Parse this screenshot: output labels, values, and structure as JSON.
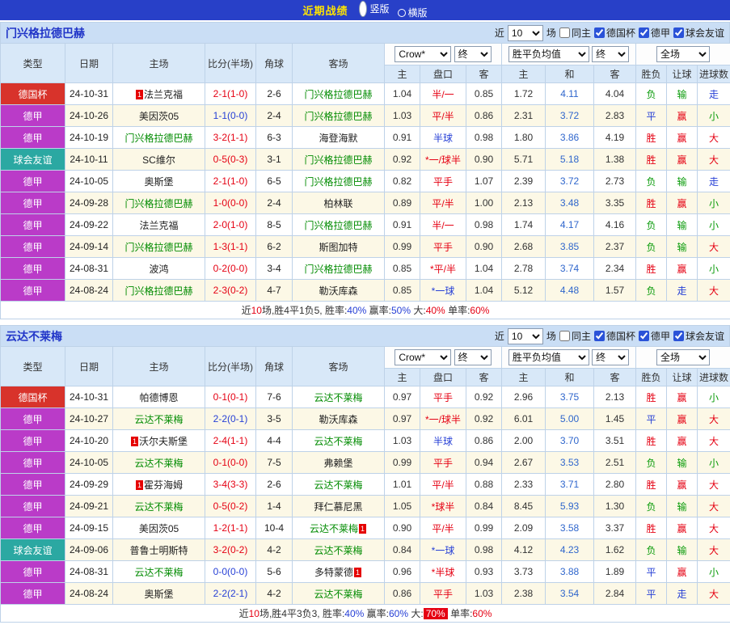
{
  "top_bar": {
    "title": "近期战绩",
    "view_options": [
      {
        "name": "vertical",
        "label": "竖版",
        "selected": true
      },
      {
        "name": "horizontal",
        "label": "横版",
        "selected": false
      }
    ]
  },
  "columns": {
    "main": [
      "类型",
      "日期",
      "主场",
      "比分(半场)",
      "角球",
      "客场"
    ],
    "sub": [
      "主",
      "盘口",
      "客",
      "主",
      "和",
      "客",
      "胜负",
      "让球",
      "进球数"
    ]
  },
  "palette": {
    "topbar_blue": "#2840C8",
    "title_yellow": "#FFE400",
    "section_head_blue": "#CADEF5",
    "table_head_blue": "#D8E8F8",
    "cup_red": "#D8332B",
    "league_purple": "#BA3BC8",
    "friendly_teal": "#2BA8A2",
    "subject_green": "#008B00",
    "win_red": "#E50012",
    "draw_blue": "#2740D6",
    "lose_green": "#0A9B0A",
    "row_stripe_cream": "#FCF8E6"
  },
  "type_colors": {
    "德国杯": "cup",
    "德甲": "league",
    "球会友谊": "friendly"
  },
  "result_colors": {
    "胜": "red",
    "平": "blue",
    "负": "green",
    "赢": "red",
    "输": "green",
    "走": "blue",
    "大": "red",
    "小": "green"
  },
  "sections": [
    {
      "id": "gladbach",
      "team": "门兴格拉德巴赫",
      "filters": {
        "near": "近",
        "count": "10",
        "unit": "场",
        "checkboxes": [
          {
            "name": "same-home",
            "label": "同主",
            "checked": false
          },
          {
            "name": "german-cup",
            "label": "德国杯",
            "checked": true
          },
          {
            "name": "bundesliga",
            "label": "德甲",
            "checked": true
          },
          {
            "name": "club-friendly",
            "label": "球会友谊",
            "checked": true
          }
        ]
      },
      "selects": {
        "odds": "Crow*",
        "odds_final": "终",
        "europe": "胜平负均值",
        "europe_final": "终",
        "scope": "全场"
      },
      "rows": [
        {
          "type": "德国杯",
          "date": "24-10-31",
          "home": "法兰克福",
          "hb": "before",
          "score": "2-1(1-0)",
          "sc": "red",
          "corner": "2-6",
          "away": "门兴格拉德巴赫",
          "sub": "a",
          "h": "1.04",
          "hcap": "半/一",
          "hc": "red",
          "a": "0.85",
          "eh": "1.72",
          "ed": "4.11",
          "ea": "4.04",
          "wl": "负",
          "rang": "输",
          "goal": "走"
        },
        {
          "type": "德甲",
          "date": "24-10-26",
          "home": "美因茨05",
          "score": "1-1(0-0)",
          "sc": "blue",
          "corner": "2-4",
          "away": "门兴格拉德巴赫",
          "sub": "a",
          "h": "1.03",
          "hcap": "平/半",
          "hc": "red",
          "a": "0.86",
          "eh": "2.31",
          "ed": "3.72",
          "ea": "2.83",
          "wl": "平",
          "rang": "赢",
          "goal": "小"
        },
        {
          "type": "德甲",
          "date": "24-10-19",
          "home": "门兴格拉德巴赫",
          "sub": "h",
          "score": "3-2(1-1)",
          "sc": "red",
          "corner": "6-3",
          "away": "海登海默",
          "h": "0.91",
          "hcap": "半球",
          "hc": "blue",
          "a": "0.98",
          "eh": "1.80",
          "ed": "3.86",
          "ea": "4.19",
          "wl": "胜",
          "rang": "赢",
          "goal": "大"
        },
        {
          "type": "球会友谊",
          "date": "24-10-11",
          "home": "SC维尔",
          "score": "0-5(0-3)",
          "sc": "red",
          "corner": "3-1",
          "away": "门兴格拉德巴赫",
          "sub": "a",
          "h": "0.92",
          "hcap": "*一/球半",
          "hc": "red",
          "a": "0.90",
          "eh": "5.71",
          "ed": "5.18",
          "ea": "1.38",
          "wl": "胜",
          "rang": "赢",
          "goal": "大"
        },
        {
          "type": "德甲",
          "date": "24-10-05",
          "home": "奥斯堡",
          "score": "2-1(1-0)",
          "sc": "red",
          "corner": "6-5",
          "away": "门兴格拉德巴赫",
          "sub": "a",
          "h": "0.82",
          "hcap": "平手",
          "hc": "red",
          "a": "1.07",
          "eh": "2.39",
          "ed": "3.72",
          "ea": "2.73",
          "wl": "负",
          "rang": "输",
          "goal": "走"
        },
        {
          "type": "德甲",
          "date": "24-09-28",
          "home": "门兴格拉德巴赫",
          "sub": "h",
          "score": "1-0(0-0)",
          "sc": "red",
          "corner": "2-4",
          "away": "柏林联",
          "h": "0.89",
          "hcap": "平/半",
          "hc": "red",
          "a": "1.00",
          "eh": "2.13",
          "ed": "3.48",
          "ea": "3.35",
          "wl": "胜",
          "rang": "赢",
          "goal": "小"
        },
        {
          "type": "德甲",
          "date": "24-09-22",
          "home": "法兰克福",
          "score": "2-0(1-0)",
          "sc": "red",
          "corner": "8-5",
          "away": "门兴格拉德巴赫",
          "sub": "a",
          "h": "0.91",
          "hcap": "半/一",
          "hc": "red",
          "a": "0.98",
          "eh": "1.74",
          "ed": "4.17",
          "ea": "4.16",
          "wl": "负",
          "rang": "输",
          "goal": "小"
        },
        {
          "type": "德甲",
          "date": "24-09-14",
          "home": "门兴格拉德巴赫",
          "sub": "h",
          "score": "1-3(1-1)",
          "sc": "red",
          "corner": "6-2",
          "away": "斯图加特",
          "h": "0.99",
          "hcap": "平手",
          "hc": "red",
          "a": "0.90",
          "eh": "2.68",
          "ed": "3.85",
          "ea": "2.37",
          "wl": "负",
          "rang": "输",
          "goal": "大"
        },
        {
          "type": "德甲",
          "date": "24-08-31",
          "home": "波鸿",
          "score": "0-2(0-0)",
          "sc": "red",
          "corner": "3-4",
          "away": "门兴格拉德巴赫",
          "sub": "a",
          "h": "0.85",
          "hcap": "*平/半",
          "hc": "red",
          "a": "1.04",
          "eh": "2.78",
          "ed": "3.74",
          "ea": "2.34",
          "wl": "胜",
          "rang": "赢",
          "goal": "小"
        },
        {
          "type": "德甲",
          "date": "24-08-24",
          "home": "门兴格拉德巴赫",
          "sub": "h",
          "score": "2-3(0-2)",
          "sc": "red",
          "corner": "4-7",
          "away": "勒沃库森",
          "h": "0.85",
          "hcap": "*一球",
          "hc": "blue",
          "a": "1.04",
          "eh": "5.12",
          "ed": "4.48",
          "ea": "1.57",
          "wl": "负",
          "rang": "走",
          "goal": "大"
        }
      ],
      "summary": [
        {
          "t": "近"
        },
        {
          "t": "10",
          "c": "red"
        },
        {
          "t": "场,胜4平1负5, 胜率:"
        },
        {
          "t": "40%",
          "c": "blue"
        },
        {
          "t": " 赢率:"
        },
        {
          "t": "50%",
          "c": "blue"
        },
        {
          "t": " 大:"
        },
        {
          "t": "40%",
          "c": "red"
        },
        {
          "t": " 单率:"
        },
        {
          "t": "60%",
          "c": "red"
        }
      ]
    },
    {
      "id": "bremen",
      "team": "云达不莱梅",
      "filters": {
        "near": "近",
        "count": "10",
        "unit": "场",
        "checkboxes": [
          {
            "name": "same-home",
            "label": "同主",
            "checked": false
          },
          {
            "name": "german-cup",
            "label": "德国杯",
            "checked": true
          },
          {
            "name": "bundesliga",
            "label": "德甲",
            "checked": true
          },
          {
            "name": "club-friendly",
            "label": "球会友谊",
            "checked": true
          }
        ]
      },
      "selects": {
        "odds": "Crow*",
        "odds_final": "终",
        "europe": "胜平负均值",
        "europe_final": "终",
        "scope": "全场"
      },
      "rows": [
        {
          "type": "德国杯",
          "date": "24-10-31",
          "home": "帕德博恩",
          "score": "0-1(0-1)",
          "sc": "red",
          "corner": "7-6",
          "away": "云达不莱梅",
          "sub": "a",
          "h": "0.97",
          "hcap": "平手",
          "hc": "red",
          "a": "0.92",
          "eh": "2.96",
          "ed": "3.75",
          "ea": "2.13",
          "wl": "胜",
          "rang": "赢",
          "goal": "小"
        },
        {
          "type": "德甲",
          "date": "24-10-27",
          "home": "云达不莱梅",
          "sub": "h",
          "score": "2-2(0-1)",
          "sc": "blue",
          "corner": "3-5",
          "away": "勒沃库森",
          "h": "0.97",
          "hcap": "*一/球半",
          "hc": "red",
          "a": "0.92",
          "eh": "6.01",
          "ed": "5.00",
          "ea": "1.45",
          "wl": "平",
          "rang": "赢",
          "goal": "大"
        },
        {
          "type": "德甲",
          "date": "24-10-20",
          "home": "沃尔夫斯堡",
          "hb": "before",
          "score": "2-4(1-1)",
          "sc": "red",
          "corner": "4-4",
          "away": "云达不莱梅",
          "sub": "a",
          "h": "1.03",
          "hcap": "半球",
          "hc": "blue",
          "a": "0.86",
          "eh": "2.00",
          "ed": "3.70",
          "ea": "3.51",
          "wl": "胜",
          "rang": "赢",
          "goal": "大"
        },
        {
          "type": "德甲",
          "date": "24-10-05",
          "home": "云达不莱梅",
          "sub": "h",
          "score": "0-1(0-0)",
          "sc": "red",
          "corner": "7-5",
          "away": "弗赖堡",
          "h": "0.99",
          "hcap": "平手",
          "hc": "red",
          "a": "0.94",
          "eh": "2.67",
          "ed": "3.53",
          "ea": "2.51",
          "wl": "负",
          "rang": "输",
          "goal": "小"
        },
        {
          "type": "德甲",
          "date": "24-09-29",
          "home": "霍芬海姆",
          "hb": "before",
          "score": "3-4(3-3)",
          "sc": "red",
          "corner": "2-6",
          "away": "云达不莱梅",
          "sub": "a",
          "h": "1.01",
          "hcap": "平/半",
          "hc": "red",
          "a": "0.88",
          "eh": "2.33",
          "ed": "3.71",
          "ea": "2.80",
          "wl": "胜",
          "rang": "赢",
          "goal": "大"
        },
        {
          "type": "德甲",
          "date": "24-09-21",
          "home": "云达不莱梅",
          "sub": "h",
          "score": "0-5(0-2)",
          "sc": "red",
          "corner": "1-4",
          "away": "拜仁慕尼黑",
          "h": "1.05",
          "hcap": "*球半",
          "hc": "red",
          "a": "0.84",
          "eh": "8.45",
          "ed": "5.93",
          "ea": "1.30",
          "wl": "负",
          "rang": "输",
          "goal": "大"
        },
        {
          "type": "德甲",
          "date": "24-09-15",
          "home": "美因茨05",
          "score": "1-2(1-1)",
          "sc": "red",
          "corner": "10-4",
          "away": "云达不莱梅",
          "ab": "after",
          "sub": "a",
          "h": "0.90",
          "hcap": "平/半",
          "hc": "red",
          "a": "0.99",
          "eh": "2.09",
          "ed": "3.58",
          "ea": "3.37",
          "wl": "胜",
          "rang": "赢",
          "goal": "大"
        },
        {
          "type": "球会友谊",
          "date": "24-09-06",
          "home": "普鲁士明斯特",
          "score": "3-2(0-2)",
          "sc": "red",
          "corner": "4-2",
          "away": "云达不莱梅",
          "sub": "a",
          "h": "0.84",
          "hcap": "*一球",
          "hc": "blue",
          "a": "0.98",
          "eh": "4.12",
          "ed": "4.23",
          "ea": "1.62",
          "wl": "负",
          "rang": "输",
          "goal": "大"
        },
        {
          "type": "德甲",
          "date": "24-08-31",
          "home": "云达不莱梅",
          "sub": "h",
          "score": "0-0(0-0)",
          "sc": "blue",
          "corner": "5-6",
          "away": "多特蒙德",
          "ab": "after",
          "h": "0.96",
          "hcap": "*半球",
          "hc": "red",
          "a": "0.93",
          "eh": "3.73",
          "ed": "3.88",
          "ea": "1.89",
          "wl": "平",
          "rang": "赢",
          "goal": "小"
        },
        {
          "type": "德甲",
          "date": "24-08-24",
          "home": "奥斯堡",
          "score": "2-2(2-1)",
          "sc": "blue",
          "corner": "4-2",
          "away": "云达不莱梅",
          "sub": "a",
          "h": "0.86",
          "hcap": "平手",
          "hc": "red",
          "a": "1.03",
          "eh": "2.38",
          "ed": "3.54",
          "ea": "2.84",
          "wl": "平",
          "rang": "走",
          "goal": "大"
        }
      ],
      "summary": [
        {
          "t": "近"
        },
        {
          "t": "10",
          "c": "red"
        },
        {
          "t": "场,胜4平3负3, 胜率:"
        },
        {
          "t": "40%",
          "c": "blue"
        },
        {
          "t": " 赢率:"
        },
        {
          "t": "60%",
          "c": "blue"
        },
        {
          "t": " 大:"
        },
        {
          "t": "70%",
          "c": "redbg"
        },
        {
          "t": " 单率:"
        },
        {
          "t": "60%",
          "c": "red"
        }
      ]
    }
  ]
}
